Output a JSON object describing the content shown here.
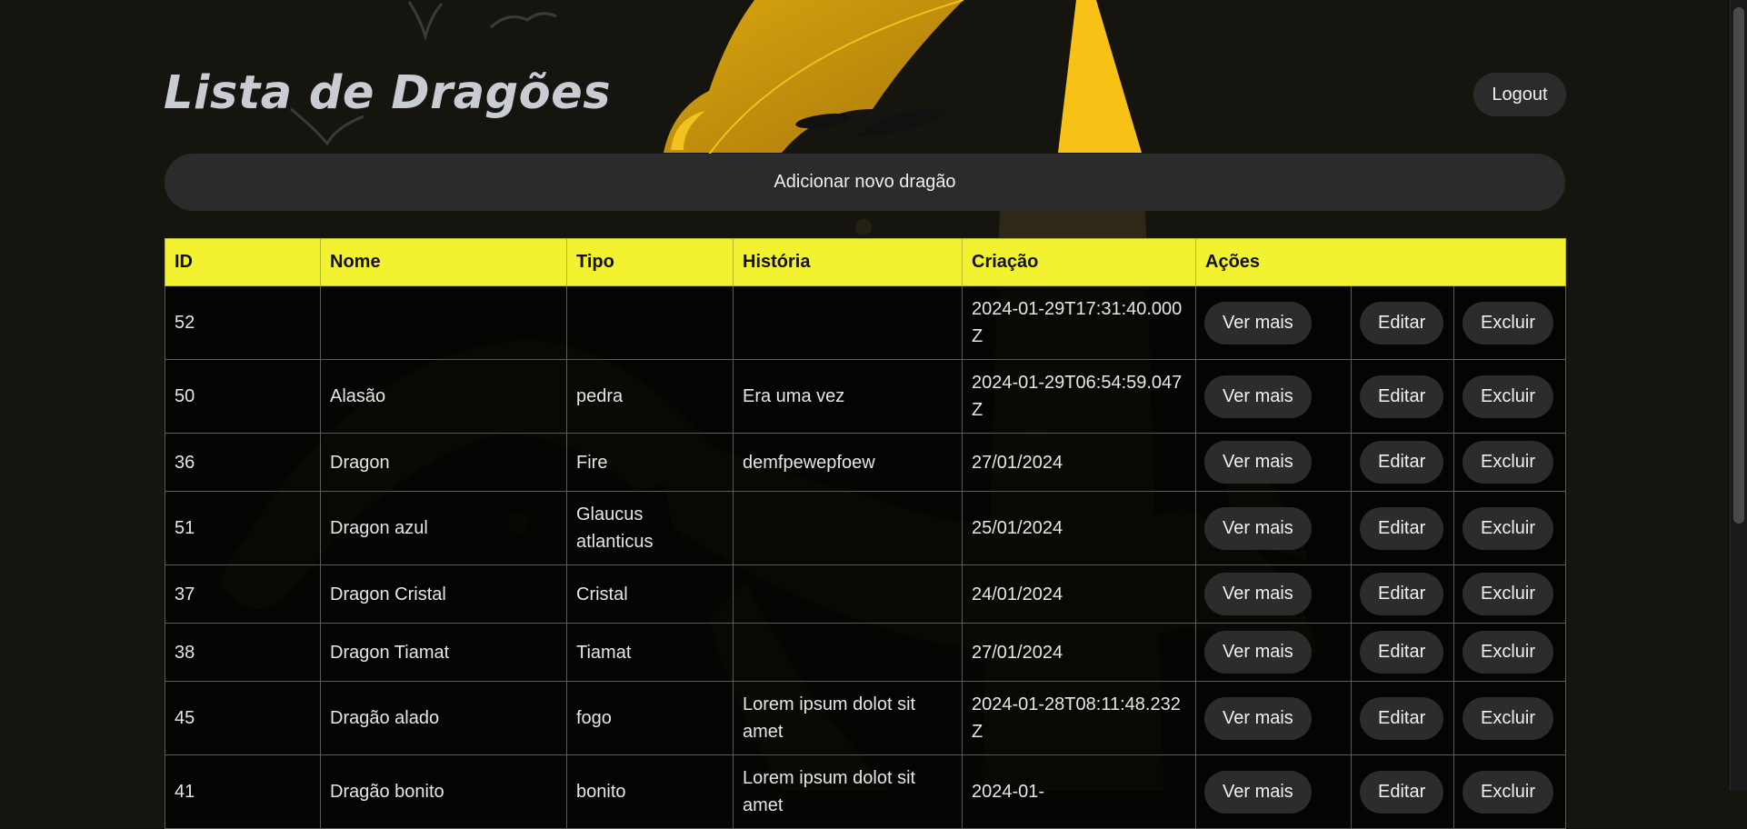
{
  "page": {
    "title": "Lista de Dragões",
    "logout_label": "Logout",
    "add_label": "Adicionar novo dragão"
  },
  "table": {
    "headers": [
      "ID",
      "Nome",
      "Tipo",
      "História",
      "Criação",
      "Ações"
    ],
    "actions": {
      "view": "Ver mais",
      "edit": "Editar",
      "delete": "Excluir"
    },
    "rows": [
      {
        "id": "52",
        "nome": "",
        "tipo": "",
        "historia": "",
        "criacao": "2024-01-29T17:31:40.000Z"
      },
      {
        "id": "50",
        "nome": "Alasão",
        "tipo": "pedra",
        "historia": "Era uma vez",
        "criacao": "2024-01-29T06:54:59.047Z"
      },
      {
        "id": "36",
        "nome": "Dragon",
        "tipo": "Fire",
        "historia": "demfpewepfoew",
        "criacao": "27/01/2024"
      },
      {
        "id": "51",
        "nome": "Dragon azul",
        "tipo": "Glaucus atlanticus",
        "historia": "",
        "criacao": "25/01/2024"
      },
      {
        "id": "37",
        "nome": "Dragon Cristal",
        "tipo": "Cristal",
        "historia": "",
        "criacao": "24/01/2024"
      },
      {
        "id": "38",
        "nome": "Dragon Tiamat",
        "tipo": "Tiamat",
        "historia": "",
        "criacao": "27/01/2024"
      },
      {
        "id": "45",
        "nome": "Dragão alado",
        "tipo": "fogo",
        "historia": "Lorem ipsum dolot sit amet",
        "criacao": "2024-01-28T08:11:48.232Z"
      },
      {
        "id": "41",
        "nome": "Dragão bonito",
        "tipo": "bonito",
        "historia": "Lorem ipsum dolot sit amet",
        "criacao": "2024-01-"
      }
    ]
  },
  "colors": {
    "background": "#16140f",
    "header_yellow": "#f2f231",
    "dragon_gold": "#c9920b",
    "button_dark": "#2b2b2b"
  },
  "icons": {
    "background_art": "dragon-illustration"
  }
}
